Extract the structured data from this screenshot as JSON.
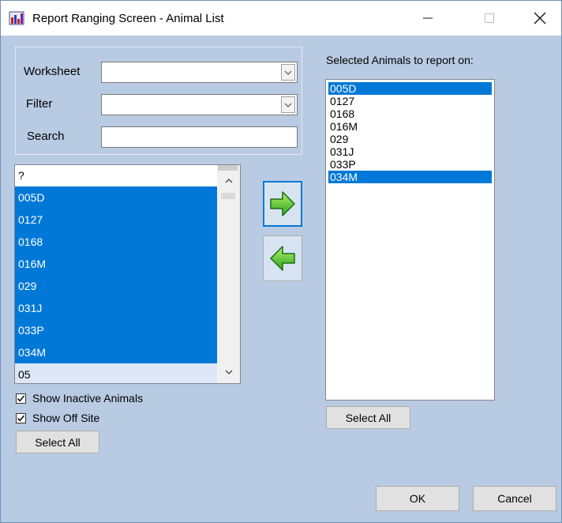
{
  "window": {
    "title": "Report Ranging Screen - Animal List",
    "icon": "report-chart-icon",
    "controls": {
      "minimize": "—",
      "maximize": "☐",
      "close": "✕"
    }
  },
  "filters": {
    "worksheet_label": "Worksheet",
    "worksheet_value": "",
    "filter_label": "Filter",
    "filter_value": "",
    "search_label": "Search",
    "search_value": ""
  },
  "available_list": {
    "items": [
      {
        "label": "?",
        "selected": false
      },
      {
        "label": "005D",
        "selected": true
      },
      {
        "label": "0127",
        "selected": true
      },
      {
        "label": "0168",
        "selected": true
      },
      {
        "label": "016M",
        "selected": true
      },
      {
        "label": "029",
        "selected": true
      },
      {
        "label": "031J",
        "selected": true
      },
      {
        "label": "033P",
        "selected": true
      },
      {
        "label": "034M",
        "selected": true
      },
      {
        "label": "05",
        "selected": false,
        "highlighted": true
      }
    ]
  },
  "options": {
    "show_inactive_label": "Show Inactive Animals",
    "show_inactive_checked": true,
    "show_off_site_label": "Show Off Site",
    "show_off_site_checked": true,
    "select_all_left": "Select All"
  },
  "move_buttons": {
    "add_icon": "green-right-arrow-icon",
    "remove_icon": "green-left-arrow-icon"
  },
  "selected_panel": {
    "label": "Selected Animals to report on:",
    "items": [
      {
        "label": "005D",
        "selected": true
      },
      {
        "label": "0127",
        "selected": false
      },
      {
        "label": "0168",
        "selected": false
      },
      {
        "label": "016M",
        "selected": false
      },
      {
        "label": "029",
        "selected": false
      },
      {
        "label": "031J",
        "selected": false
      },
      {
        "label": "033P",
        "selected": false
      },
      {
        "label": "034M",
        "selected": true
      }
    ],
    "select_all": "Select All"
  },
  "footer": {
    "ok": "OK",
    "cancel": "Cancel"
  },
  "colors": {
    "background": "#b8cbe3",
    "selection": "#0078d7",
    "arrow_green": "#33b624"
  }
}
